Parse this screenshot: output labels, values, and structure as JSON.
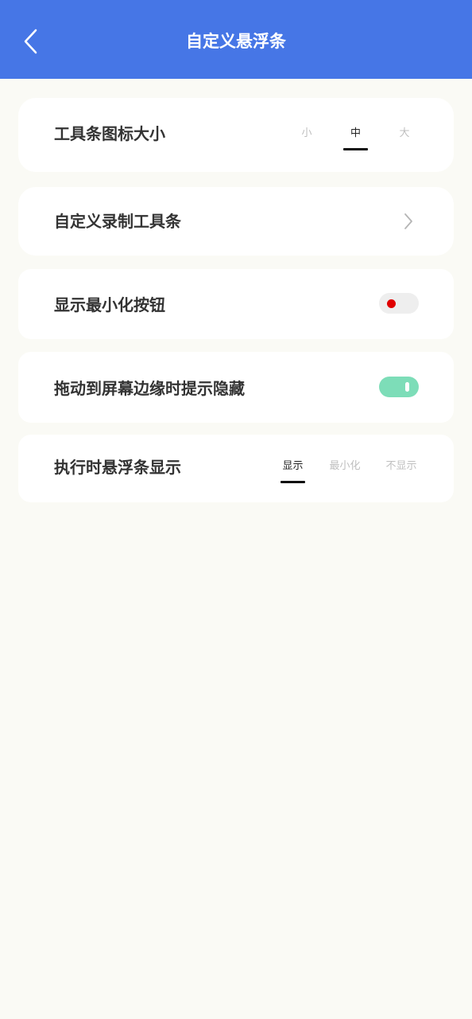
{
  "header": {
    "title": "自定义悬浮条",
    "back_icon": "chevron-left-icon",
    "background_color": "#4676e6"
  },
  "settings": {
    "toolbar_icon_size": {
      "label": "工具条图标大小",
      "options": [
        "小",
        "中",
        "大"
      ],
      "selected": "中"
    },
    "custom_record_toolbar": {
      "label": "自定义录制工具条",
      "icon": "chevron-right-icon"
    },
    "show_minimize_button": {
      "label": "显示最小化按钮",
      "enabled": false,
      "off_indicator_color": "#e00000"
    },
    "edge_hide_hint": {
      "label": "拖动到屏幕边缘时提示隐藏",
      "enabled": true,
      "on_color": "#7dddb8"
    },
    "float_display_when_running": {
      "label": "执行时悬浮条显示",
      "options": [
        "显示",
        "最小化",
        "不显示"
      ],
      "selected": "显示"
    }
  }
}
